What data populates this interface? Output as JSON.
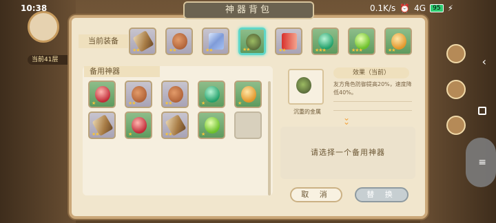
{
  "statusbar": {
    "time": "10:38",
    "network": "0.1K/s",
    "signal": "4G",
    "battery": "95"
  },
  "panel": {
    "title": "神器背包",
    "equipped_label": "当前装备",
    "reserve_label": "备用神器",
    "effect_title": "效果（当前）",
    "effect_text": "友方角色防御提高20%，速度降低40%。",
    "selected_name": "沉重的金属",
    "select_prompt": "请选择一个备用神器",
    "cancel_label": "取 消",
    "replace_label": "替 换"
  },
  "background": {
    "level_text": "当前41层"
  },
  "equipped": [
    {
      "icon": "horn-icon",
      "stars": "★★",
      "bg": "blue"
    },
    {
      "icon": "meat-icon",
      "stars": "★★",
      "bg": "blue"
    },
    {
      "icon": "crystal-icon",
      "stars": "★★",
      "bg": "blue"
    },
    {
      "icon": "metal-rock-icon",
      "stars": "★★",
      "bg": "green",
      "selected": true
    },
    {
      "icon": "megaphone-icon",
      "stars": "★★",
      "bg": "blue"
    },
    {
      "icon": "green-gem-icon",
      "stars": "★★★",
      "bg": "green"
    },
    {
      "icon": "lime-gem-icon",
      "stars": "★★★",
      "bg": "green"
    },
    {
      "icon": "orange-gem-icon",
      "stars": "★★",
      "bg": "green"
    }
  ],
  "reserve": [
    {
      "icon": "red-gem-icon",
      "stars": "★",
      "bg": "green"
    },
    {
      "icon": "meat-icon",
      "stars": "★★",
      "bg": "blue"
    },
    {
      "icon": "meat-icon",
      "stars": "★★",
      "bg": "blue"
    },
    {
      "icon": "green-gem-icon",
      "stars": "★",
      "bg": "green"
    },
    {
      "icon": "orange-gem-icon",
      "stars": "★",
      "bg": "green"
    },
    {
      "icon": "horn-icon",
      "stars": "★★",
      "bg": "blue"
    },
    {
      "icon": "red-gem-icon",
      "stars": "★",
      "bg": "green"
    },
    {
      "icon": "horn-icon",
      "stars": "★★",
      "bg": "blue"
    },
    {
      "icon": "lime-gem-icon",
      "stars": "★",
      "bg": "green"
    },
    {
      "icon": "empty",
      "stars": "",
      "bg": "empty"
    }
  ]
}
